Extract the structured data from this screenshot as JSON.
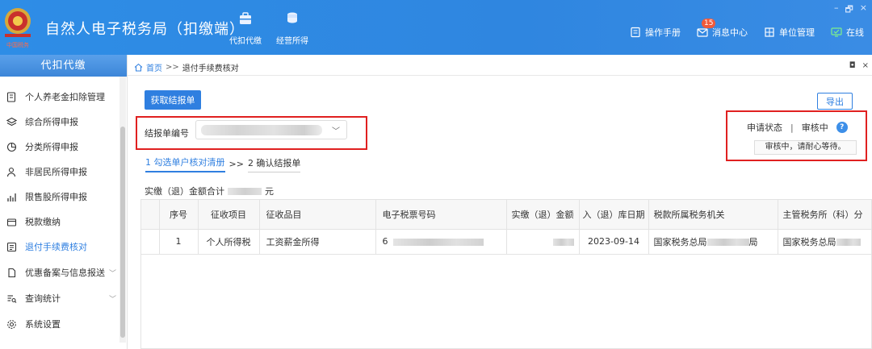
{
  "app": {
    "title": "自然人电子税务局（扣缴端）",
    "logo_text": "中国税务"
  },
  "top_nav": [
    {
      "label": "代扣代缴",
      "icon": "briefcase-icon"
    },
    {
      "label": "经营所得",
      "icon": "coin-stack-icon"
    }
  ],
  "top_right": {
    "manual": "操作手册",
    "messages": "消息中心",
    "message_count": "15",
    "unit_mgmt": "单位管理",
    "online": "在线"
  },
  "window_controls": [
    "–",
    "🗗",
    "×"
  ],
  "sidebar": {
    "header": "代扣代缴",
    "items": [
      {
        "label": "个人养老金扣除管理",
        "icon": "document-icon",
        "active": false
      },
      {
        "label": "综合所得申报",
        "icon": "layers-icon",
        "active": false
      },
      {
        "label": "分类所得申报",
        "icon": "pie-chart-icon",
        "active": false
      },
      {
        "label": "非居民所得申报",
        "icon": "person-icon",
        "active": false
      },
      {
        "label": "限售股所得申报",
        "icon": "bar-chart-icon",
        "active": false
      },
      {
        "label": "税款缴纳",
        "icon": "wallet-icon",
        "active": false
      },
      {
        "label": "退付手续费核对",
        "icon": "checklist-icon",
        "active": true
      },
      {
        "label": "优惠备案与信息报送",
        "icon": "file-icon",
        "active": false,
        "expandable": true
      },
      {
        "label": "查询统计",
        "icon": "query-icon",
        "active": false,
        "expandable": true
      },
      {
        "label": "系统设置",
        "icon": "gear-icon",
        "active": false
      }
    ]
  },
  "breadcrumb": {
    "home": "首页",
    "separator": ">>",
    "current": "退付手续费核对"
  },
  "content": {
    "get_report_button": "获取结报单",
    "export_button": "导出",
    "report_no_label": "结报单编号",
    "status_label": "申请状态",
    "status_separator": "|",
    "status_value": "审核中",
    "status_message": "审核中，请耐心等待。",
    "help_icon": "?",
    "step1": "1 勾选单户核对清册",
    "step_sep": ">>",
    "step2": "2 确认结报单",
    "total_label": "实缴（退）金额合计",
    "total_unit": "元"
  },
  "table": {
    "headers": [
      "",
      "序号",
      "征收项目",
      "征收品目",
      "电子税票号码",
      "实缴（退）金额",
      "入（退）库日期",
      "税款所属税务机关",
      "主管税务所（科）分"
    ],
    "rows": [
      {
        "seq": "1",
        "item": "个人所得税",
        "category": "工资薪金所得",
        "ticket_prefix": "6",
        "date": "2023-09-14",
        "tax_office_prefix": "国家税务总局",
        "tax_office_suffix": "局",
        "branch_prefix": "国家税务总局"
      }
    ]
  },
  "colors": {
    "header_blue": "#2f86e0",
    "accent_blue": "#2f7fe0",
    "highlight_red": "#e02020"
  }
}
